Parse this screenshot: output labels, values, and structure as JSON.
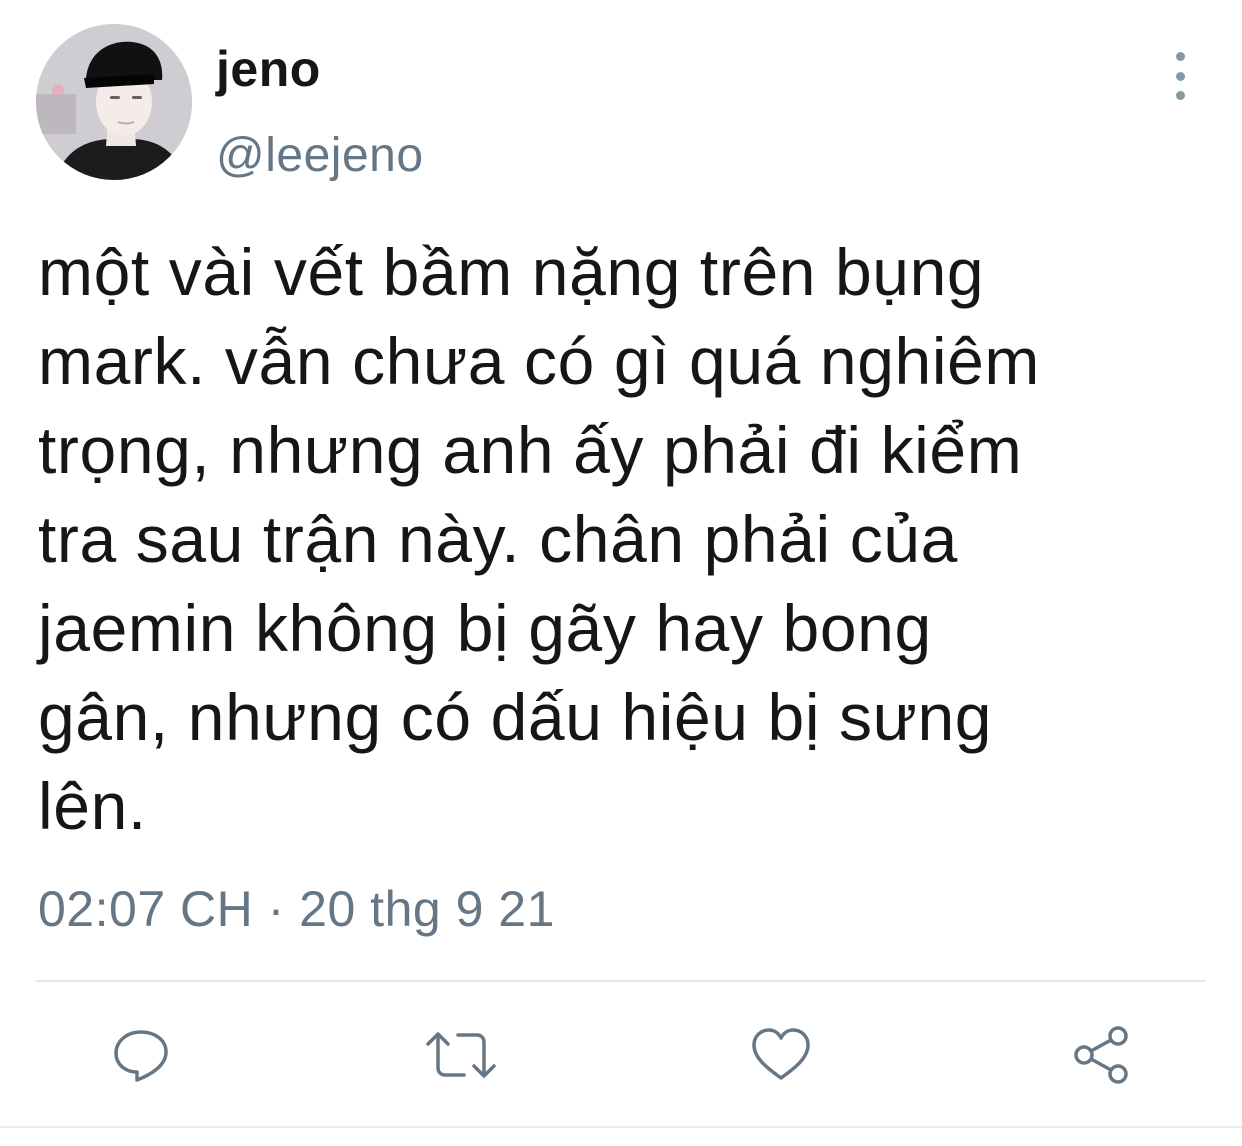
{
  "user": {
    "display_name": "jeno",
    "handle": "@leejeno"
  },
  "tweet": {
    "text": "một vài vết bầm nặng trên bụng\nmark. vẫn chưa có gì quá nghiêm\ntrọng, nhưng anh ấy phải đi kiểm\ntra sau trận này. chân phải của\njaemin không bị gãy hay bong\ngân, nhưng có dấu hiệu bị sưng\nlên.",
    "timestamp": "02:07 CH · 20 thg 9 21"
  },
  "actions": {
    "reply_icon": "reply-icon",
    "retweet_icon": "retweet-icon",
    "like_icon": "heart-icon",
    "share_icon": "share-icon"
  },
  "colors": {
    "text": "#14171a",
    "secondary": "#657786",
    "icon": "#657786",
    "divider": "#e1e8ed"
  }
}
